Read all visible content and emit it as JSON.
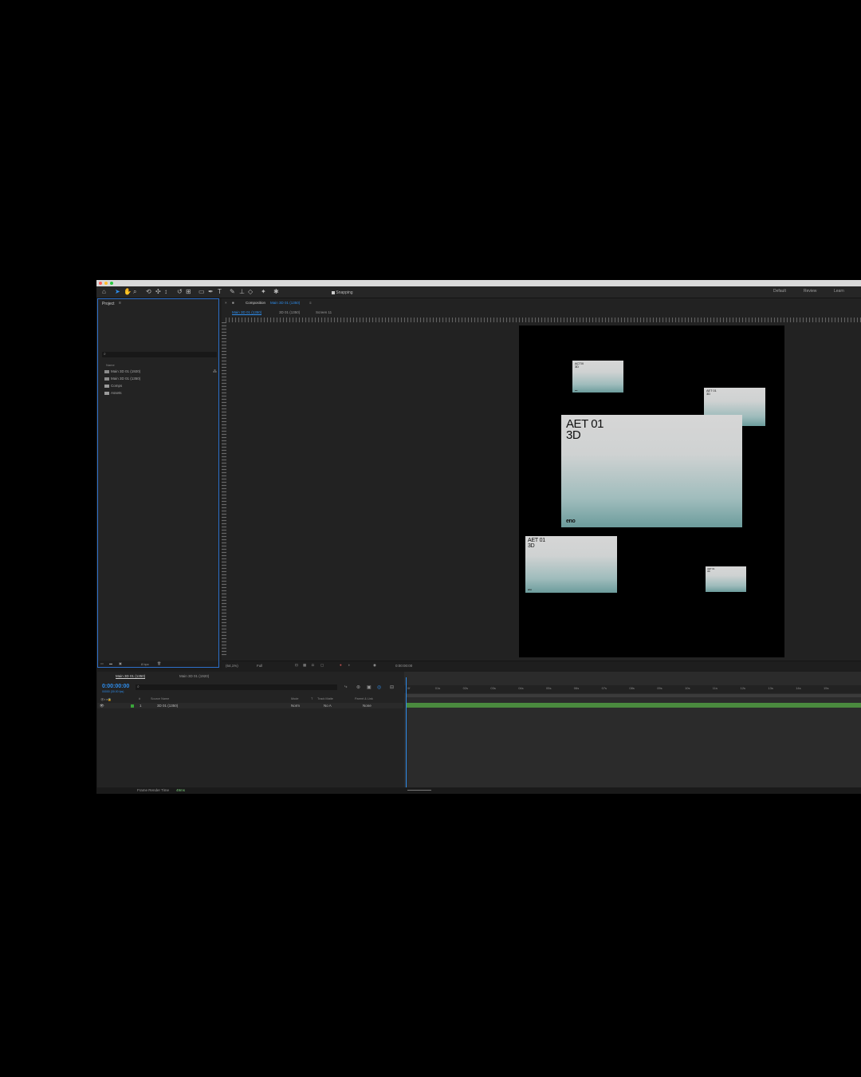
{
  "toolbar": {
    "snapping_label": "Snapping",
    "workspaces": [
      "Default",
      "Review",
      "Learn"
    ]
  },
  "project": {
    "title": "Project",
    "column_name": "Name",
    "items": [
      {
        "label": "Main 3D 01 (1920)",
        "icon": "composition-icon"
      },
      {
        "label": "Main 3D 01 (1350)",
        "icon": "composition-icon"
      },
      {
        "label": "Comps",
        "icon": "folder-icon"
      },
      {
        "label": "Assets",
        "icon": "folder-icon"
      }
    ],
    "bpc": "8 bpc"
  },
  "composition": {
    "panel_label": "Composition",
    "comp_name": "Main 3D 01 (1350)",
    "tabs": [
      "Main 3D 01 (1350)",
      "3D 01 (1350)",
      "Screen 11"
    ],
    "zoom": "(64,1%)",
    "resolution": "Full",
    "timecode": "0:00:00:00",
    "cards": [
      {
        "title_line1": "AET 01",
        "title_line2": "3D",
        "logo": "eno"
      },
      {
        "title_line1": "AET 01",
        "title_line2": "3D",
        "logo": "eno"
      },
      {
        "title_line1": "ACTIX",
        "title_line2": "3D",
        "logo": "eno"
      },
      {
        "title_line1": "AET 01",
        "title_line2": "3D",
        "logo": "eno"
      },
      {
        "title_line1": "AET 01",
        "title_line2": "3D",
        "logo": "eno"
      }
    ]
  },
  "timeline": {
    "tabs": [
      "Main 3D 01 (1350)",
      "Main 3D 01 (1920)"
    ],
    "current_time": "0:00:00:00",
    "frame_info": "00000 (30.00 fps)",
    "columns": [
      "#",
      "Source Name",
      "Mode",
      "T",
      "Track Matte",
      "Parent & Link"
    ],
    "layer": {
      "index": "1",
      "name": "3D 01 (1350)",
      "mode": "Norm",
      "matte": "No A",
      "parent": "None"
    },
    "ruler_ticks": [
      "0f",
      "01s",
      "02s",
      "03s",
      "04s",
      "05s",
      "06s",
      "07s",
      "08s",
      "09s",
      "10s",
      "11s",
      "12s",
      "13s",
      "14s",
      "15s"
    ]
  },
  "status": {
    "render_label": "Frame Render Time",
    "render_value": "49ms"
  },
  "colors": {
    "accent": "#2d8ceb",
    "track_green": "#4a8a3e",
    "card_top": "#d6d6d6",
    "card_bottom": "#6c9c9c"
  }
}
